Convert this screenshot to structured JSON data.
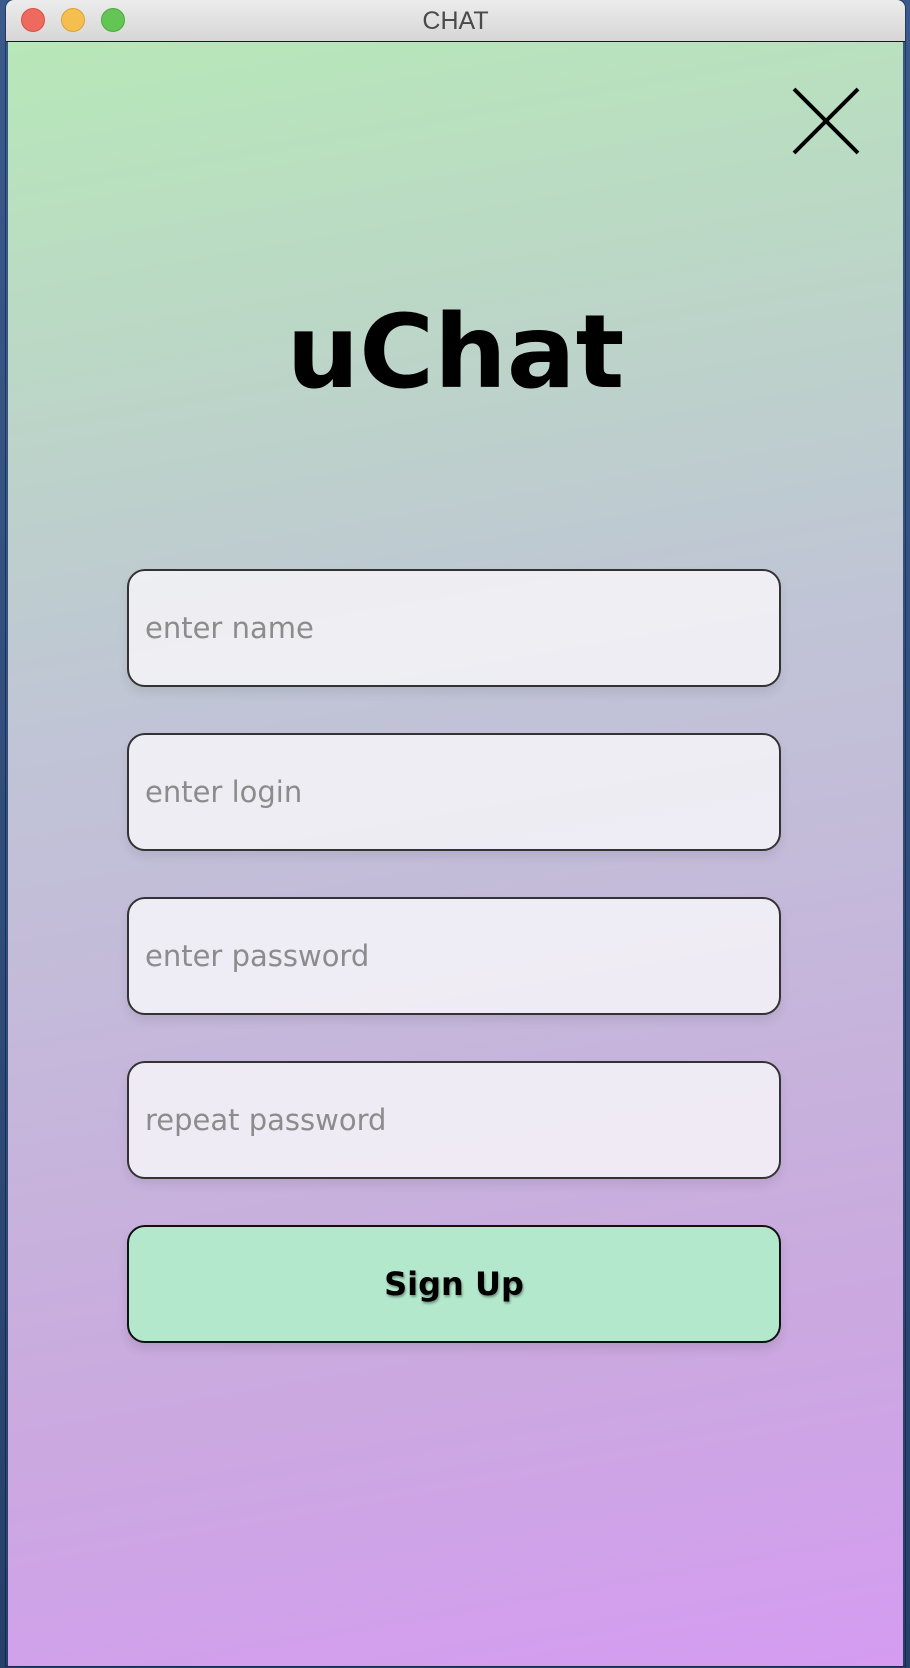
{
  "window": {
    "title": "CHAT"
  },
  "app": {
    "title": "uChat"
  },
  "form": {
    "name_placeholder": "enter name",
    "login_placeholder": "enter login",
    "password_placeholder": "enter password",
    "repeat_password_placeholder": "repeat password",
    "signup_label": "Sign Up"
  },
  "icons": {
    "close": "close-icon"
  },
  "colors": {
    "gradient_top": "#b7e8b8",
    "gradient_bottom": "#d59cf2",
    "signup_button": "#b3e8cd",
    "traffic_close": "#ee6a5f",
    "traffic_minimize": "#f5be4f",
    "traffic_zoom": "#62c554"
  }
}
